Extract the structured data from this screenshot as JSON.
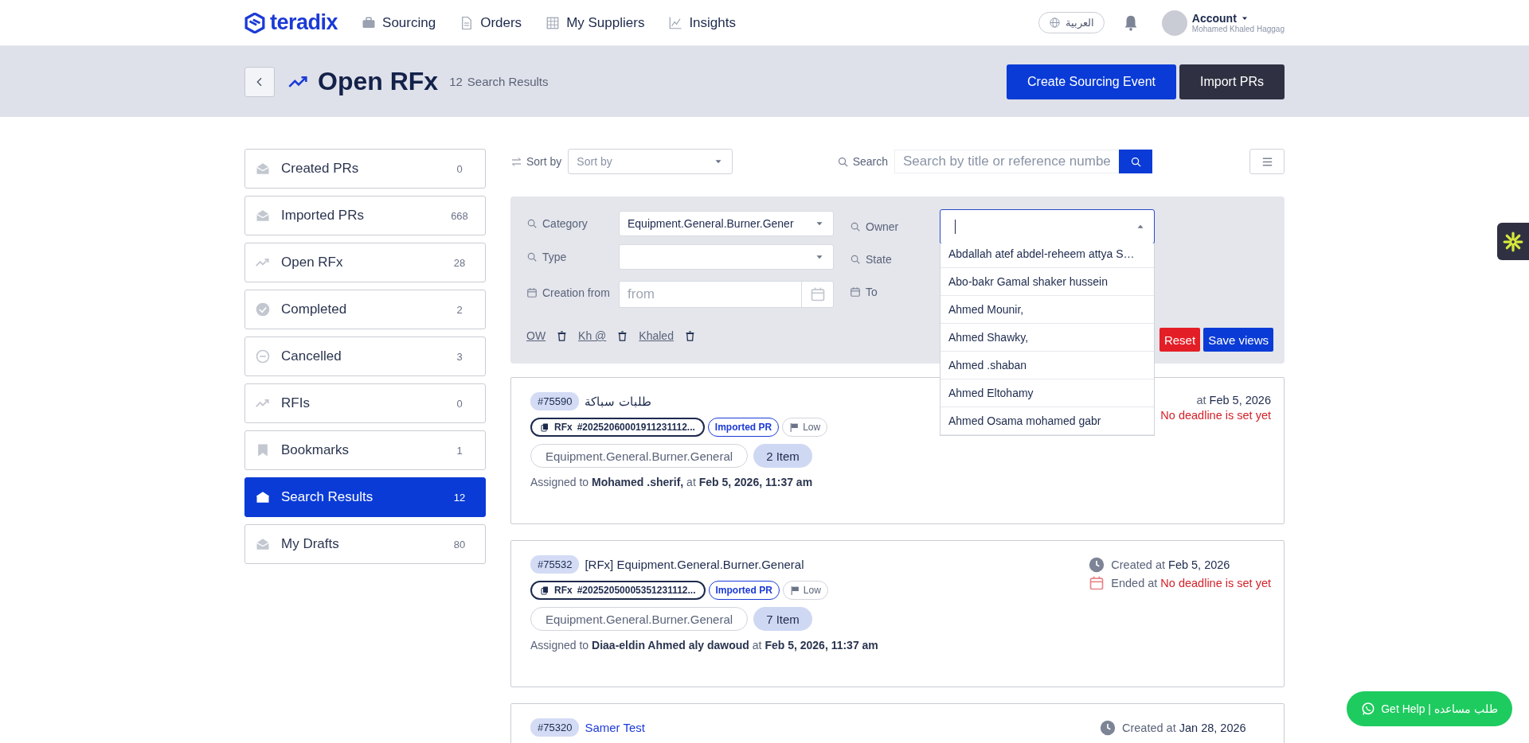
{
  "nav": {
    "logo": "teradix",
    "items": [
      {
        "label": "Sourcing"
      },
      {
        "label": "Orders"
      },
      {
        "label": "My Suppliers"
      },
      {
        "label": "Insights"
      }
    ],
    "language": "العربية",
    "account": {
      "label": "Account",
      "user": "Mohamed Khaled Haggag"
    }
  },
  "page_header": {
    "title": "Open RFx",
    "count": "12",
    "count_label": "Search Results",
    "buttons": [
      {
        "label": "Create Sourcing Event",
        "kind": "primary"
      },
      {
        "label": "Import PRs",
        "kind": "dark"
      }
    ]
  },
  "sidebar": {
    "items": [
      {
        "label": "Created PRs",
        "count": "0",
        "selected": false
      },
      {
        "label": "Imported PRs",
        "count": "668",
        "selected": false
      },
      {
        "label": "Open RFx",
        "count": "28",
        "selected": false
      },
      {
        "label": "Completed",
        "count": "2",
        "selected": false
      },
      {
        "label": "Cancelled",
        "count": "3",
        "selected": false
      },
      {
        "label": "RFIs",
        "count": "0",
        "selected": false
      },
      {
        "label": "Bookmarks",
        "count": "1",
        "selected": false
      },
      {
        "label": "Search Results",
        "count": "12",
        "selected": true
      },
      {
        "label": "My Drafts",
        "count": "80",
        "selected": false
      }
    ]
  },
  "toolbar": {
    "sort_label": "Sort by",
    "sort_placeholder": "Sort by",
    "search_label": "Search",
    "search_placeholder": "Search by title or reference numbe"
  },
  "filters": {
    "fields": [
      {
        "label": "Category",
        "kind": "select",
        "value": "Equipment.General.Burner.Gener"
      },
      {
        "label": "Type",
        "kind": "select"
      },
      {
        "label": "Creation from",
        "kind": "date",
        "placeholder": "from"
      }
    ],
    "right_fields": [
      {
        "label": "Owner",
        "kind": "select"
      },
      {
        "label": "State",
        "kind": "select"
      },
      {
        "label": "To",
        "kind": "date"
      }
    ],
    "saved_views": [
      "OW",
      "Kh @",
      "Khaled"
    ],
    "buttons": [
      {
        "label": "Reset",
        "kind": "danger"
      },
      {
        "label": "Save views",
        "kind": "primary"
      }
    ],
    "owner_dropdown": {
      "expanded": true,
      "options": [
        "Abdallah atef abdel-reheem attya S…",
        "Abo-bakr Gamal shaker hussein",
        "Ahmed Mounir,",
        "Ahmed Shawky,",
        "Ahmed .shaban",
        "Ahmed Eltohamy",
        "Ahmed Osama mohamed gabr"
      ]
    }
  },
  "cards": [
    {
      "id": "#75590",
      "title": "طلبات سباكة",
      "title_link": false,
      "ref_type": "RFx",
      "reference": "#20252060001911231112...",
      "source": "Imported PR",
      "priority": "Low",
      "category": "Equipment.General.Burner.General",
      "items": "2 Item",
      "assigned_label": "Assigned to",
      "assignee": "Mohamed .sherif,",
      "at_label": "at",
      "assigned_at": "Feb 5, 2026, 11:37 am",
      "meta": [
        {
          "kind": "created",
          "icon": false,
          "label": "at",
          "value": "Feb 5, 2026"
        },
        {
          "kind": "ended",
          "icon": false,
          "value": "No deadline is set yet"
        }
      ]
    },
    {
      "id": "#75532",
      "title": "[RFx] Equipment.General.Burner.General",
      "title_link": false,
      "ref_type": "RFx",
      "reference": "#20252050005351231112...",
      "source": "Imported PR",
      "priority": "Low",
      "category": "Equipment.General.Burner.General",
      "items": "7 Item",
      "assigned_label": "Assigned to",
      "assignee": "Diaa-eldin Ahmed aly dawoud",
      "at_label": "at",
      "assigned_at": "Feb 5, 2026, 11:37 am",
      "meta": [
        {
          "kind": "created",
          "icon": true,
          "label": "Created at",
          "value": "Feb 5, 2026"
        },
        {
          "kind": "ended",
          "icon": true,
          "label": "Ended at",
          "value": "No deadline is set yet"
        }
      ]
    },
    {
      "id": "#75320",
      "title": "Samer Test",
      "title_link": true,
      "meta": [
        {
          "kind": "created",
          "icon": true,
          "label": "Created at",
          "value": "Jan 28, 2026"
        }
      ]
    }
  ],
  "help_button": {
    "label": "Get Help | طلب مساعده"
  }
}
